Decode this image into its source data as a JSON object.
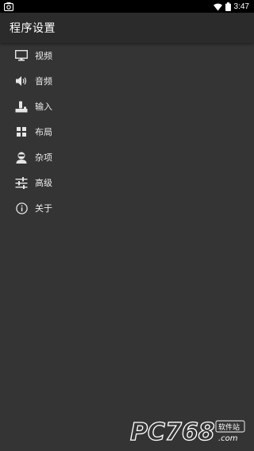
{
  "status_bar": {
    "time": "3:47",
    "icons": [
      "screenshot-icon",
      "wifi-icon",
      "battery-icon"
    ]
  },
  "app_bar": {
    "title": "程序设置"
  },
  "menu": {
    "items": [
      {
        "label": "视频",
        "icon": "monitor-icon"
      },
      {
        "label": "音频",
        "icon": "speaker-icon"
      },
      {
        "label": "输入",
        "icon": "joystick-icon"
      },
      {
        "label": "布局",
        "icon": "grid-icon"
      },
      {
        "label": "杂项",
        "icon": "person-icon"
      },
      {
        "label": "高级",
        "icon": "sliders-icon"
      },
      {
        "label": "关于",
        "icon": "info-icon"
      }
    ]
  },
  "watermark": {
    "logo_text": "PC768",
    "sub_text": "软件站",
    "domain_text": ".com"
  },
  "colors": {
    "background": "#343434",
    "app_bar": "#2b2b2b",
    "status_bar": "#000000",
    "text": "#ececec"
  }
}
